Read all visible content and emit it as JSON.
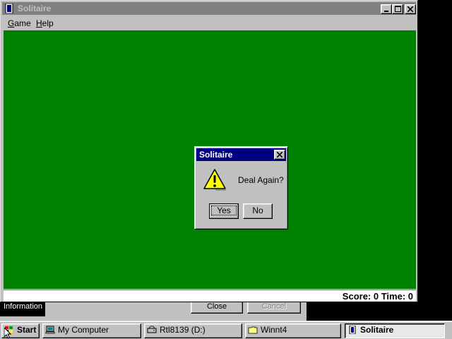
{
  "background_window": {
    "info_label": "Information",
    "close_label": "Close",
    "cancel_label": "Cancel"
  },
  "window": {
    "title": "Solitaire",
    "icon": "solitaire-card-icon",
    "controls": {
      "minimize": "minimize-icon",
      "maximize": "maximize-icon",
      "close": "close-icon"
    }
  },
  "menu": {
    "game": {
      "mnemonic": "G",
      "rest": "ame"
    },
    "help": {
      "mnemonic": "H",
      "rest": "elp"
    }
  },
  "status": {
    "text": "Score: 0 Time: 0"
  },
  "dialog": {
    "title": "Solitaire",
    "icon": "warning-icon",
    "message": "Deal Again?",
    "yes_label": "Yes",
    "no_label": "No"
  },
  "taskbar": {
    "start_label": "Start",
    "items": [
      {
        "label": "My Computer",
        "icon": "computer-icon"
      },
      {
        "label": "Rtl8139 (D:)",
        "icon": "drive-icon"
      },
      {
        "label": "Winnt4",
        "icon": "folder-icon"
      },
      {
        "label": "Solitaire",
        "icon": "solitaire-card-icon",
        "active": true
      }
    ]
  },
  "colors": {
    "felt": "#008000",
    "face": "#c0c0c0",
    "active_title": "#000080",
    "inactive_title": "#808080"
  }
}
